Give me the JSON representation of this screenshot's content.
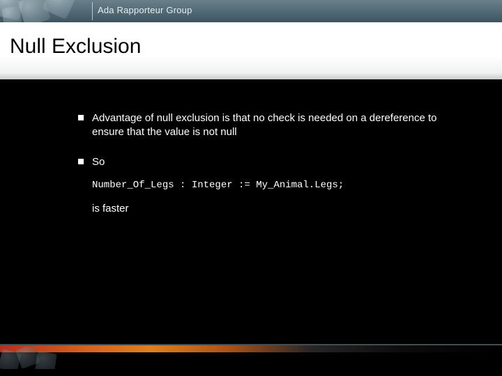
{
  "header": {
    "group_label": "Ada Rapporteur Group"
  },
  "title": "Null Exclusion",
  "bullets": [
    {
      "text": "Advantage of null exclusion is that no check is needed on a dereference to ensure that the value is not null"
    },
    {
      "text": "So",
      "code": "Number_Of_Legs : Integer := My_Animal.Legs;",
      "after_code": "is faster"
    }
  ]
}
